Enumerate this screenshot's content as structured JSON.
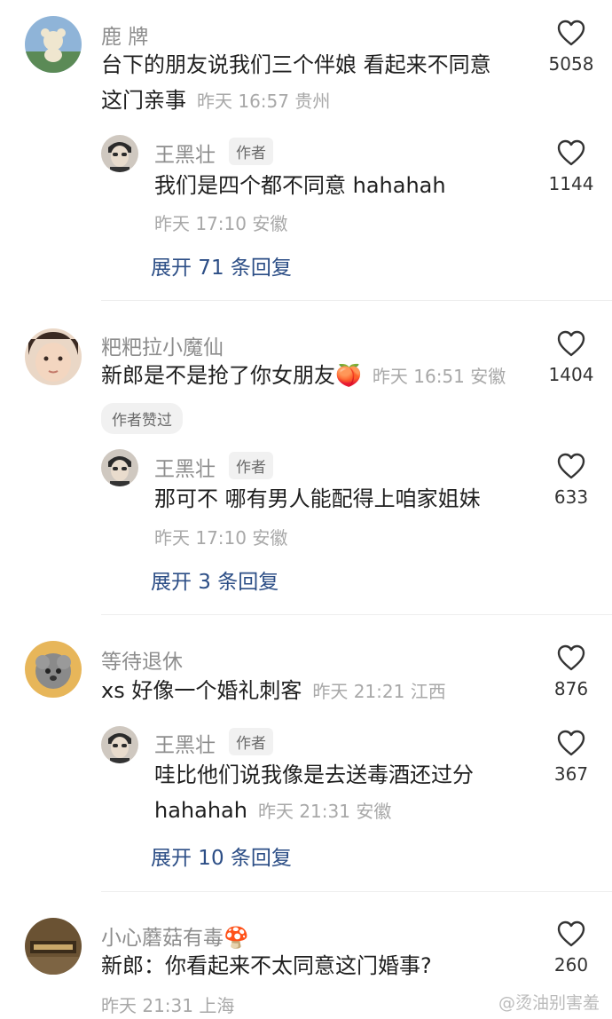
{
  "comments": [
    {
      "user": "鹿 牌",
      "text_line1": "台下的朋友说我们三个伴娘 看起来不同意",
      "text_line2": "这门亲事",
      "time": "昨天 16:57 贵州",
      "likes": "5058",
      "reply": {
        "user": "王黑壮",
        "tag": "作者",
        "text": "我们是四个都不同意 hahahah",
        "time": "昨天 17:10 安徽",
        "likes": "1144"
      },
      "expand": "展开 71 条回复"
    },
    {
      "user": "粑粑拉小魔仙",
      "text": "新郎是不是抢了你女朋友",
      "emoji": "🍑",
      "time": "昨天 16:51 安徽",
      "likes": "1404",
      "liked_tag": "作者赞过",
      "reply": {
        "user": "王黑壮",
        "tag": "作者",
        "text": "那可不 哪有男人能配得上咱家姐妹",
        "time": "昨天 17:10 安徽",
        "likes": "633"
      },
      "expand": "展开 3 条回复"
    },
    {
      "user": "等待退休",
      "text": "xs 好像一个婚礼刺客",
      "time": "昨天 21:21 江西",
      "likes": "876",
      "reply": {
        "user": "王黑壮",
        "tag": "作者",
        "text_line1": "哇比他们说我像是去送毒酒还过分",
        "text_line2": "hahahah",
        "time": "昨天 21:31 安徽",
        "likes": "367"
      },
      "expand": "展开 10 条回复"
    },
    {
      "user": "小心蘑菇有毒",
      "emoji": "🍄",
      "text": "新郎：你看起来不太同意这门婚事?",
      "time": "昨天 21:31 上海",
      "likes": "260"
    }
  ],
  "watermark": "@烫油别害羞",
  "colors": {
    "link": "#2c4e86",
    "meta": "#a8a8a8",
    "name": "#8d8d8d"
  }
}
